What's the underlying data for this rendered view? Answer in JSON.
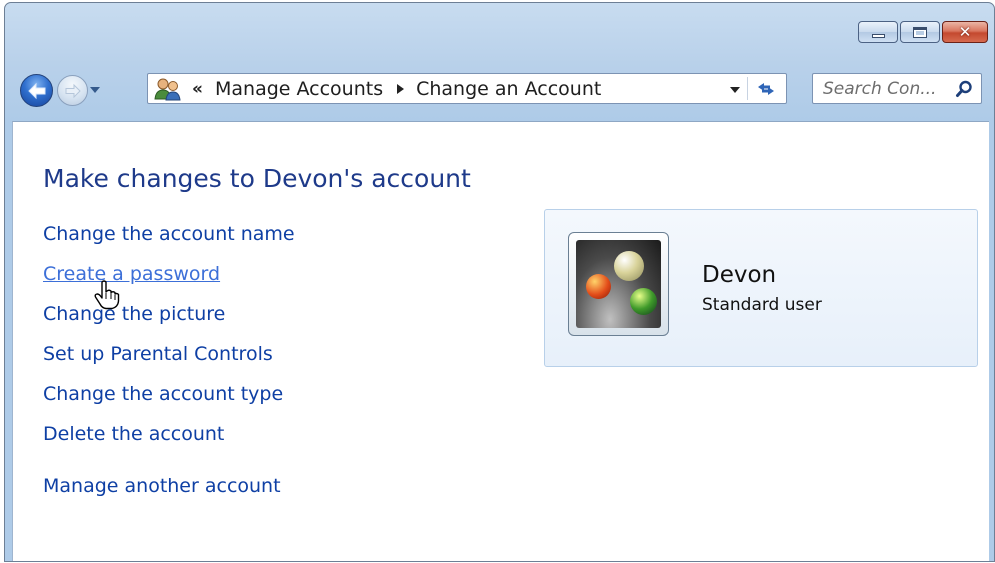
{
  "window": {
    "controls": {
      "minimize_icon": "minimize-icon",
      "maximize_icon": "maximize-icon",
      "close_icon": "close-icon"
    }
  },
  "nav": {
    "back_icon": "back-arrow-icon",
    "forward_icon": "forward-arrow-icon",
    "breadcrumb_prefix": "«",
    "breadcrumbs": [
      "Manage Accounts",
      "Change an Account"
    ],
    "search_placeholder": "Search Con..."
  },
  "content": {
    "title": "Make changes to Devon's account",
    "tasks": [
      "Change the account name",
      "Create a password",
      "Change the picture",
      "Set up Parental Controls",
      "Change the account type",
      "Delete the account"
    ],
    "extra_task": "Manage another account",
    "hovered_task_index": 1
  },
  "account": {
    "name": "Devon",
    "type": "Standard user"
  },
  "colors": {
    "link": "#0e3fa4",
    "link_hover": "#3c6fd8",
    "title": "#1e3a8a",
    "card_border": "#b8d0e9"
  }
}
